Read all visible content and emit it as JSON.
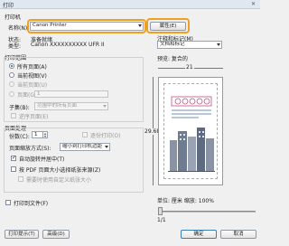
{
  "window": {
    "title": "打印",
    "close": "✕"
  },
  "printer_group": {
    "heading": "打印机",
    "name_label": "名称(N):",
    "name_value": "Canon Printer",
    "properties_button": "属性(E)",
    "status_label": "状态:",
    "status_value": "准备就绪",
    "type_label": "类型:",
    "type_value": "Canon XXXXXXXXXX UFR II",
    "comment_label": "注释和标记(M)",
    "comment_value": "文档和标记"
  },
  "print_range": {
    "heading": "打印范围",
    "all_pages": "所有页面(A)",
    "current_view": "当前视图(V)",
    "current_page": "当前页面(U)",
    "pages_label": "页面(G)",
    "pages_value": "1",
    "subset_label": "子集(B):",
    "subset_value": "范围中的所有页面",
    "reverse_pages": "逆序页面(E)"
  },
  "page_handling": {
    "heading": "页面处理",
    "copies_label": "份数(C):",
    "copies_value": "1",
    "collate_label": "逐份打印(O)",
    "scaling_label": "页面缩放方式(S):",
    "scaling_value": "缩小到打印机边距",
    "auto_rotate": "自动旋转并居中(T)",
    "pdf_paper": "按 PDF 页面大小选择纸张来源(Z)",
    "custom_paper": "需要时使用自定义纸张大小"
  },
  "print_to_file": "打印到文件(F)",
  "preview": {
    "label": "预览: 复合的",
    "width_value": "21",
    "height_value": "29.68",
    "units_label": "单位: 厘米 缩放: 100%",
    "page_counter": "1/1"
  },
  "footer": {
    "tips_button": "打印提示(T)",
    "advanced_button": "高级(D)",
    "ok_button": "确定",
    "cancel_button": "取消"
  }
}
